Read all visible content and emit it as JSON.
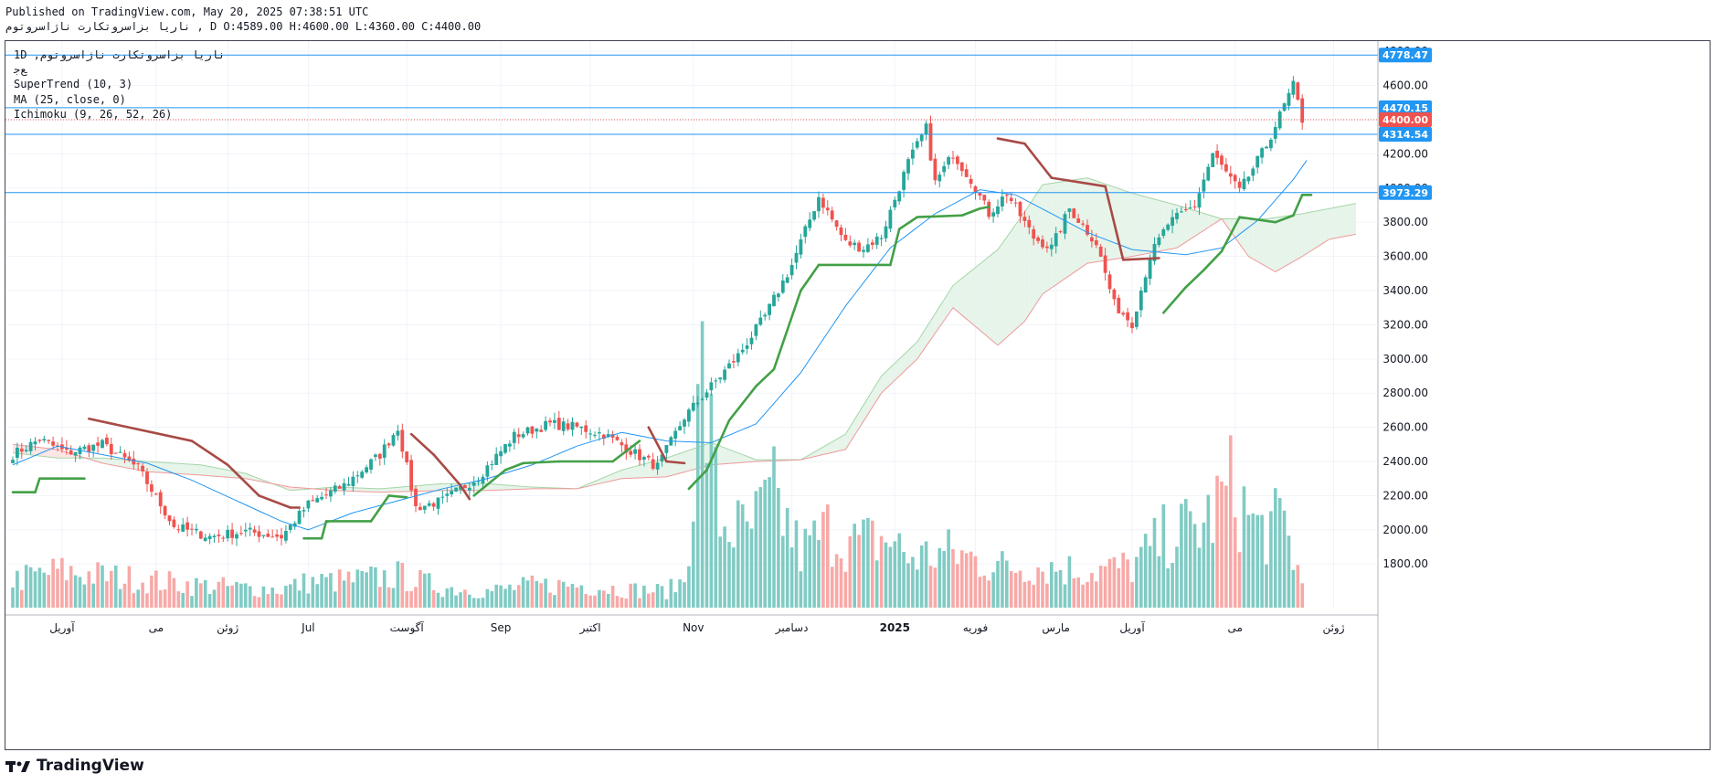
{
  "header": {
    "published": "Published on TradingView.com, May 20, 2025 07:38:51 UTC",
    "ohlc_line": "ناریا بزاسروتکارت ناژاسروتوم , D O:4589.00 H:4600.00 L:4360.00 C:4400.00"
  },
  "legend": {
    "symbol_line": "1D ,ناریا بزاسروتکارت ناژاسروتوم",
    "exchange": "ﻊﺟ",
    "supertrend": "SuperTrend (10, 3)",
    "ma": "MA (25, close, 0)",
    "ichimoku": "Ichimoku (9, 26, 52, 26)"
  },
  "footer": {
    "brand": "TradingView"
  },
  "colors": {
    "up": "#26a69a",
    "down": "#ef5350",
    "supertrend_up": "#43a047",
    "supertrend_down": "#a84a45",
    "ma": "#2196f3",
    "hline": "#2196f3",
    "last_price": "#ef5350",
    "cloud_bull": "#e6f4ea",
    "cloud_bear": "#fbe5e5"
  },
  "chart_data": {
    "type": "candlestick",
    "price_scale": {
      "min": 1630,
      "max": 4860,
      "ticks": [
        1800,
        2000,
        2200,
        2400,
        2600,
        2800,
        3000,
        3200,
        3400,
        3600,
        3800,
        4000,
        4200,
        4400,
        4600,
        4800
      ]
    },
    "x_axis_labels": [
      "آوریل",
      "می",
      "ژوئن",
      "Jul",
      "آگوست",
      "Sep",
      "اکتبر",
      "Nov",
      "دسامبر",
      "2025",
      "فوریه",
      "مارس",
      "آوریل",
      "می",
      "ژوئن"
    ],
    "x_axis_label_index": [
      11,
      32,
      48,
      66,
      88,
      109,
      129,
      152,
      174,
      197,
      215,
      233,
      250,
      273,
      295
    ],
    "horizontal_lines": [
      4778.47,
      4470.15,
      4314.54,
      3973.29
    ],
    "last_price": 4400.0,
    "price_labels": [
      {
        "text": "4778.47",
        "value": 4778.47,
        "color": "#2196f3"
      },
      {
        "text": "4470.15",
        "value": 4470.15,
        "color": "#2196f3"
      },
      {
        "text": "4400.00",
        "value": 4400.0,
        "color": "#ef5350"
      },
      {
        "text": "4314.54",
        "value": 4314.54,
        "color": "#2196f3"
      },
      {
        "text": "3973.29",
        "value": 3973.29,
        "color": "#2196f3"
      }
    ],
    "close_anchors": [
      [
        0,
        2440
      ],
      [
        6,
        2530
      ],
      [
        12,
        2450
      ],
      [
        20,
        2500
      ],
      [
        28,
        2360
      ],
      [
        36,
        2020
      ],
      [
        44,
        1960
      ],
      [
        52,
        1990
      ],
      [
        60,
        1960
      ],
      [
        66,
        2150
      ],
      [
        74,
        2260
      ],
      [
        82,
        2440
      ],
      [
        86,
        2600
      ],
      [
        90,
        2130
      ],
      [
        96,
        2170
      ],
      [
        104,
        2310
      ],
      [
        112,
        2550
      ],
      [
        120,
        2620
      ],
      [
        126,
        2600
      ],
      [
        132,
        2560
      ],
      [
        140,
        2430
      ],
      [
        144,
        2370
      ],
      [
        150,
        2660
      ],
      [
        156,
        2840
      ],
      [
        162,
        3020
      ],
      [
        168,
        3250
      ],
      [
        174,
        3550
      ],
      [
        180,
        3950
      ],
      [
        186,
        3680
      ],
      [
        190,
        3650
      ],
      [
        194,
        3720
      ],
      [
        200,
        4150
      ],
      [
        204,
        4350
      ],
      [
        206,
        4030
      ],
      [
        210,
        4200
      ],
      [
        214,
        4050
      ],
      [
        218,
        3850
      ],
      [
        222,
        3970
      ],
      [
        228,
        3710
      ],
      [
        232,
        3650
      ],
      [
        236,
        3880
      ],
      [
        242,
        3680
      ],
      [
        246,
        3320
      ],
      [
        250,
        3210
      ],
      [
        254,
        3600
      ],
      [
        258,
        3790
      ],
      [
        264,
        3900
      ],
      [
        268,
        4200
      ],
      [
        274,
        3980
      ],
      [
        280,
        4250
      ],
      [
        286,
        4600
      ],
      [
        288,
        4400
      ]
    ],
    "supertrend_anchors": [
      [
        0,
        2220,
        1
      ],
      [
        5,
        2220,
        1
      ],
      [
        6,
        2300,
        1
      ],
      [
        16,
        2300,
        1
      ],
      [
        17,
        2650,
        0
      ],
      [
        40,
        2520,
        0
      ],
      [
        48,
        2380,
        0
      ],
      [
        55,
        2200,
        0
      ],
      [
        62,
        2130,
        0
      ],
      [
        64,
        2130,
        0
      ],
      [
        65,
        1950,
        1
      ],
      [
        69,
        1950,
        1
      ],
      [
        70,
        2050,
        1
      ],
      [
        80,
        2050,
        1
      ],
      [
        84,
        2200,
        1
      ],
      [
        88,
        2190,
        1
      ],
      [
        89,
        2560,
        0
      ],
      [
        94,
        2440,
        0
      ],
      [
        100,
        2260,
        0
      ],
      [
        102,
        2180,
        0
      ],
      [
        103,
        2200,
        1
      ],
      [
        110,
        2350,
        1
      ],
      [
        114,
        2390,
        1
      ],
      [
        122,
        2400,
        1
      ],
      [
        134,
        2400,
        1
      ],
      [
        140,
        2520,
        1
      ],
      [
        142,
        2600,
        0
      ],
      [
        146,
        2400,
        0
      ],
      [
        150,
        2390,
        0
      ],
      [
        151,
        2240,
        1
      ],
      [
        155,
        2350,
        1
      ],
      [
        160,
        2640,
        1
      ],
      [
        166,
        2840,
        1
      ],
      [
        170,
        2940,
        1
      ],
      [
        176,
        3400,
        1
      ],
      [
        180,
        3550,
        1
      ],
      [
        196,
        3550,
        1
      ],
      [
        198,
        3760,
        1
      ],
      [
        202,
        3830,
        1
      ],
      [
        212,
        3840,
        1
      ],
      [
        216,
        3880,
        1
      ],
      [
        218,
        3890,
        1
      ],
      [
        220,
        4290,
        0
      ],
      [
        226,
        4260,
        0
      ],
      [
        232,
        4060,
        0
      ],
      [
        244,
        4010,
        0
      ],
      [
        248,
        3580,
        0
      ],
      [
        256,
        3590,
        0
      ],
      [
        257,
        3270,
        1
      ],
      [
        262,
        3420,
        1
      ],
      [
        266,
        3520,
        1
      ],
      [
        270,
        3630,
        1
      ],
      [
        274,
        3830,
        1
      ],
      [
        282,
        3800,
        1
      ],
      [
        286,
        3840,
        1
      ],
      [
        288,
        3960,
        1
      ],
      [
        290,
        3960,
        1
      ]
    ],
    "ma_anchors": [
      [
        0,
        2380
      ],
      [
        10,
        2490
      ],
      [
        20,
        2440
      ],
      [
        30,
        2390
      ],
      [
        40,
        2290
      ],
      [
        50,
        2170
      ],
      [
        60,
        2050
      ],
      [
        66,
        2000
      ],
      [
        76,
        2100
      ],
      [
        86,
        2170
      ],
      [
        96,
        2240
      ],
      [
        106,
        2300
      ],
      [
        116,
        2380
      ],
      [
        126,
        2490
      ],
      [
        136,
        2570
      ],
      [
        146,
        2520
      ],
      [
        156,
        2510
      ],
      [
        166,
        2620
      ],
      [
        176,
        2920
      ],
      [
        186,
        3310
      ],
      [
        196,
        3650
      ],
      [
        206,
        3850
      ],
      [
        216,
        3990
      ],
      [
        224,
        3960
      ],
      [
        232,
        3850
      ],
      [
        240,
        3740
      ],
      [
        250,
        3640
      ],
      [
        262,
        3610
      ],
      [
        270,
        3650
      ],
      [
        278,
        3810
      ],
      [
        286,
        4050
      ],
      [
        290,
        4200
      ]
    ],
    "cloud_a_anchors": [
      [
        0,
        2450
      ],
      [
        10,
        2420
      ],
      [
        20,
        2420
      ],
      [
        30,
        2400
      ],
      [
        42,
        2380
      ],
      [
        52,
        2330
      ],
      [
        62,
        2230
      ],
      [
        72,
        2250
      ],
      [
        82,
        2240
      ],
      [
        96,
        2270
      ],
      [
        106,
        2270
      ],
      [
        116,
        2250
      ],
      [
        126,
        2240
      ],
      [
        136,
        2350
      ],
      [
        146,
        2420
      ],
      [
        156,
        2510
      ],
      [
        166,
        2410
      ],
      [
        176,
        2410
      ],
      [
        186,
        2560
      ],
      [
        194,
        2900
      ],
      [
        202,
        3100
      ],
      [
        210,
        3430
      ],
      [
        220,
        3640
      ],
      [
        226,
        3860
      ],
      [
        230,
        4020
      ],
      [
        240,
        4060
      ],
      [
        250,
        3970
      ],
      [
        260,
        3900
      ],
      [
        270,
        3820
      ],
      [
        280,
        3820
      ],
      [
        288,
        3850
      ],
      [
        294,
        3880
      ],
      [
        302,
        3920
      ]
    ],
    "cloud_b_anchors": [
      [
        0,
        2500
      ],
      [
        10,
        2470
      ],
      [
        20,
        2390
      ],
      [
        30,
        2340
      ],
      [
        42,
        2320
      ],
      [
        52,
        2300
      ],
      [
        62,
        2250
      ],
      [
        72,
        2230
      ],
      [
        82,
        2220
      ],
      [
        96,
        2230
      ],
      [
        106,
        2230
      ],
      [
        116,
        2240
      ],
      [
        126,
        2240
      ],
      [
        136,
        2300
      ],
      [
        146,
        2310
      ],
      [
        156,
        2380
      ],
      [
        166,
        2400
      ],
      [
        176,
        2410
      ],
      [
        186,
        2470
      ],
      [
        194,
        2800
      ],
      [
        202,
        3000
      ],
      [
        210,
        3300
      ],
      [
        220,
        3080
      ],
      [
        226,
        3220
      ],
      [
        230,
        3380
      ],
      [
        240,
        3560
      ],
      [
        250,
        3600
      ],
      [
        260,
        3650
      ],
      [
        270,
        3820
      ],
      [
        276,
        3600
      ],
      [
        282,
        3510
      ],
      [
        288,
        3600
      ],
      [
        294,
        3700
      ],
      [
        302,
        3740
      ]
    ],
    "volume_anchors": [
      [
        0,
        30
      ],
      [
        10,
        40
      ],
      [
        20,
        35
      ],
      [
        30,
        30
      ],
      [
        40,
        25
      ],
      [
        50,
        22
      ],
      [
        60,
        20
      ],
      [
        66,
        28
      ],
      [
        76,
        30
      ],
      [
        86,
        35
      ],
      [
        96,
        22
      ],
      [
        106,
        18
      ],
      [
        116,
        24
      ],
      [
        126,
        25
      ],
      [
        136,
        20
      ],
      [
        146,
        18
      ],
      [
        150,
        30
      ],
      [
        152,
        140
      ],
      [
        154,
        250
      ],
      [
        158,
        95
      ],
      [
        164,
        80
      ],
      [
        170,
        120
      ],
      [
        176,
        60
      ],
      [
        182,
        85
      ],
      [
        188,
        70
      ],
      [
        196,
        75
      ],
      [
        200,
        55
      ],
      [
        210,
        60
      ],
      [
        220,
        45
      ],
      [
        230,
        45
      ],
      [
        240,
        40
      ],
      [
        250,
        45
      ],
      [
        258,
        80
      ],
      [
        266,
        90
      ],
      [
        272,
        130
      ],
      [
        278,
        85
      ],
      [
        284,
        90
      ],
      [
        288,
        25
      ]
    ]
  }
}
